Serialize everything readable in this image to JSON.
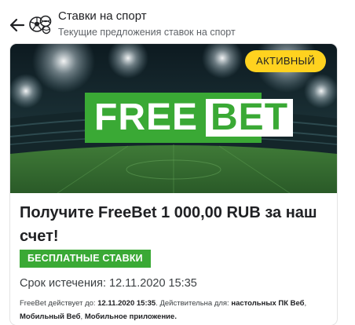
{
  "header": {
    "title": "Ставки на спорт",
    "subtitle": "Текущие предложения ставок на спорт",
    "back_icon": "arrow-left-icon",
    "sport_icon": "sports-balls-icon"
  },
  "offer": {
    "status": "АКТИВНЫЙ",
    "logo_free": "FREE",
    "logo_bet": "BET",
    "title": "Получите FreeBet 1 000,00 RUB за наш счет!",
    "category": "БЕСПЛАТНЫЕ СТАВКИ",
    "expiry": "Срок истечения: 12.11.2020 15:35",
    "terms": {
      "valid_until_label": "FreeBet действует до: ",
      "valid_until_value": "12.11.2020 15:35",
      "platforms_label": ". Действительна для: ",
      "platform_1": "настольных ПК Веб",
      "sep_1": ", ",
      "platform_2": "Мобильный Веб",
      "sep_2": ", ",
      "platform_3": "Мобильное приложение",
      "end": "."
    }
  },
  "colors": {
    "brand_green": "#3aa935",
    "status_yellow": "#ffd21f",
    "stadium_dark": "#0f1e24"
  }
}
